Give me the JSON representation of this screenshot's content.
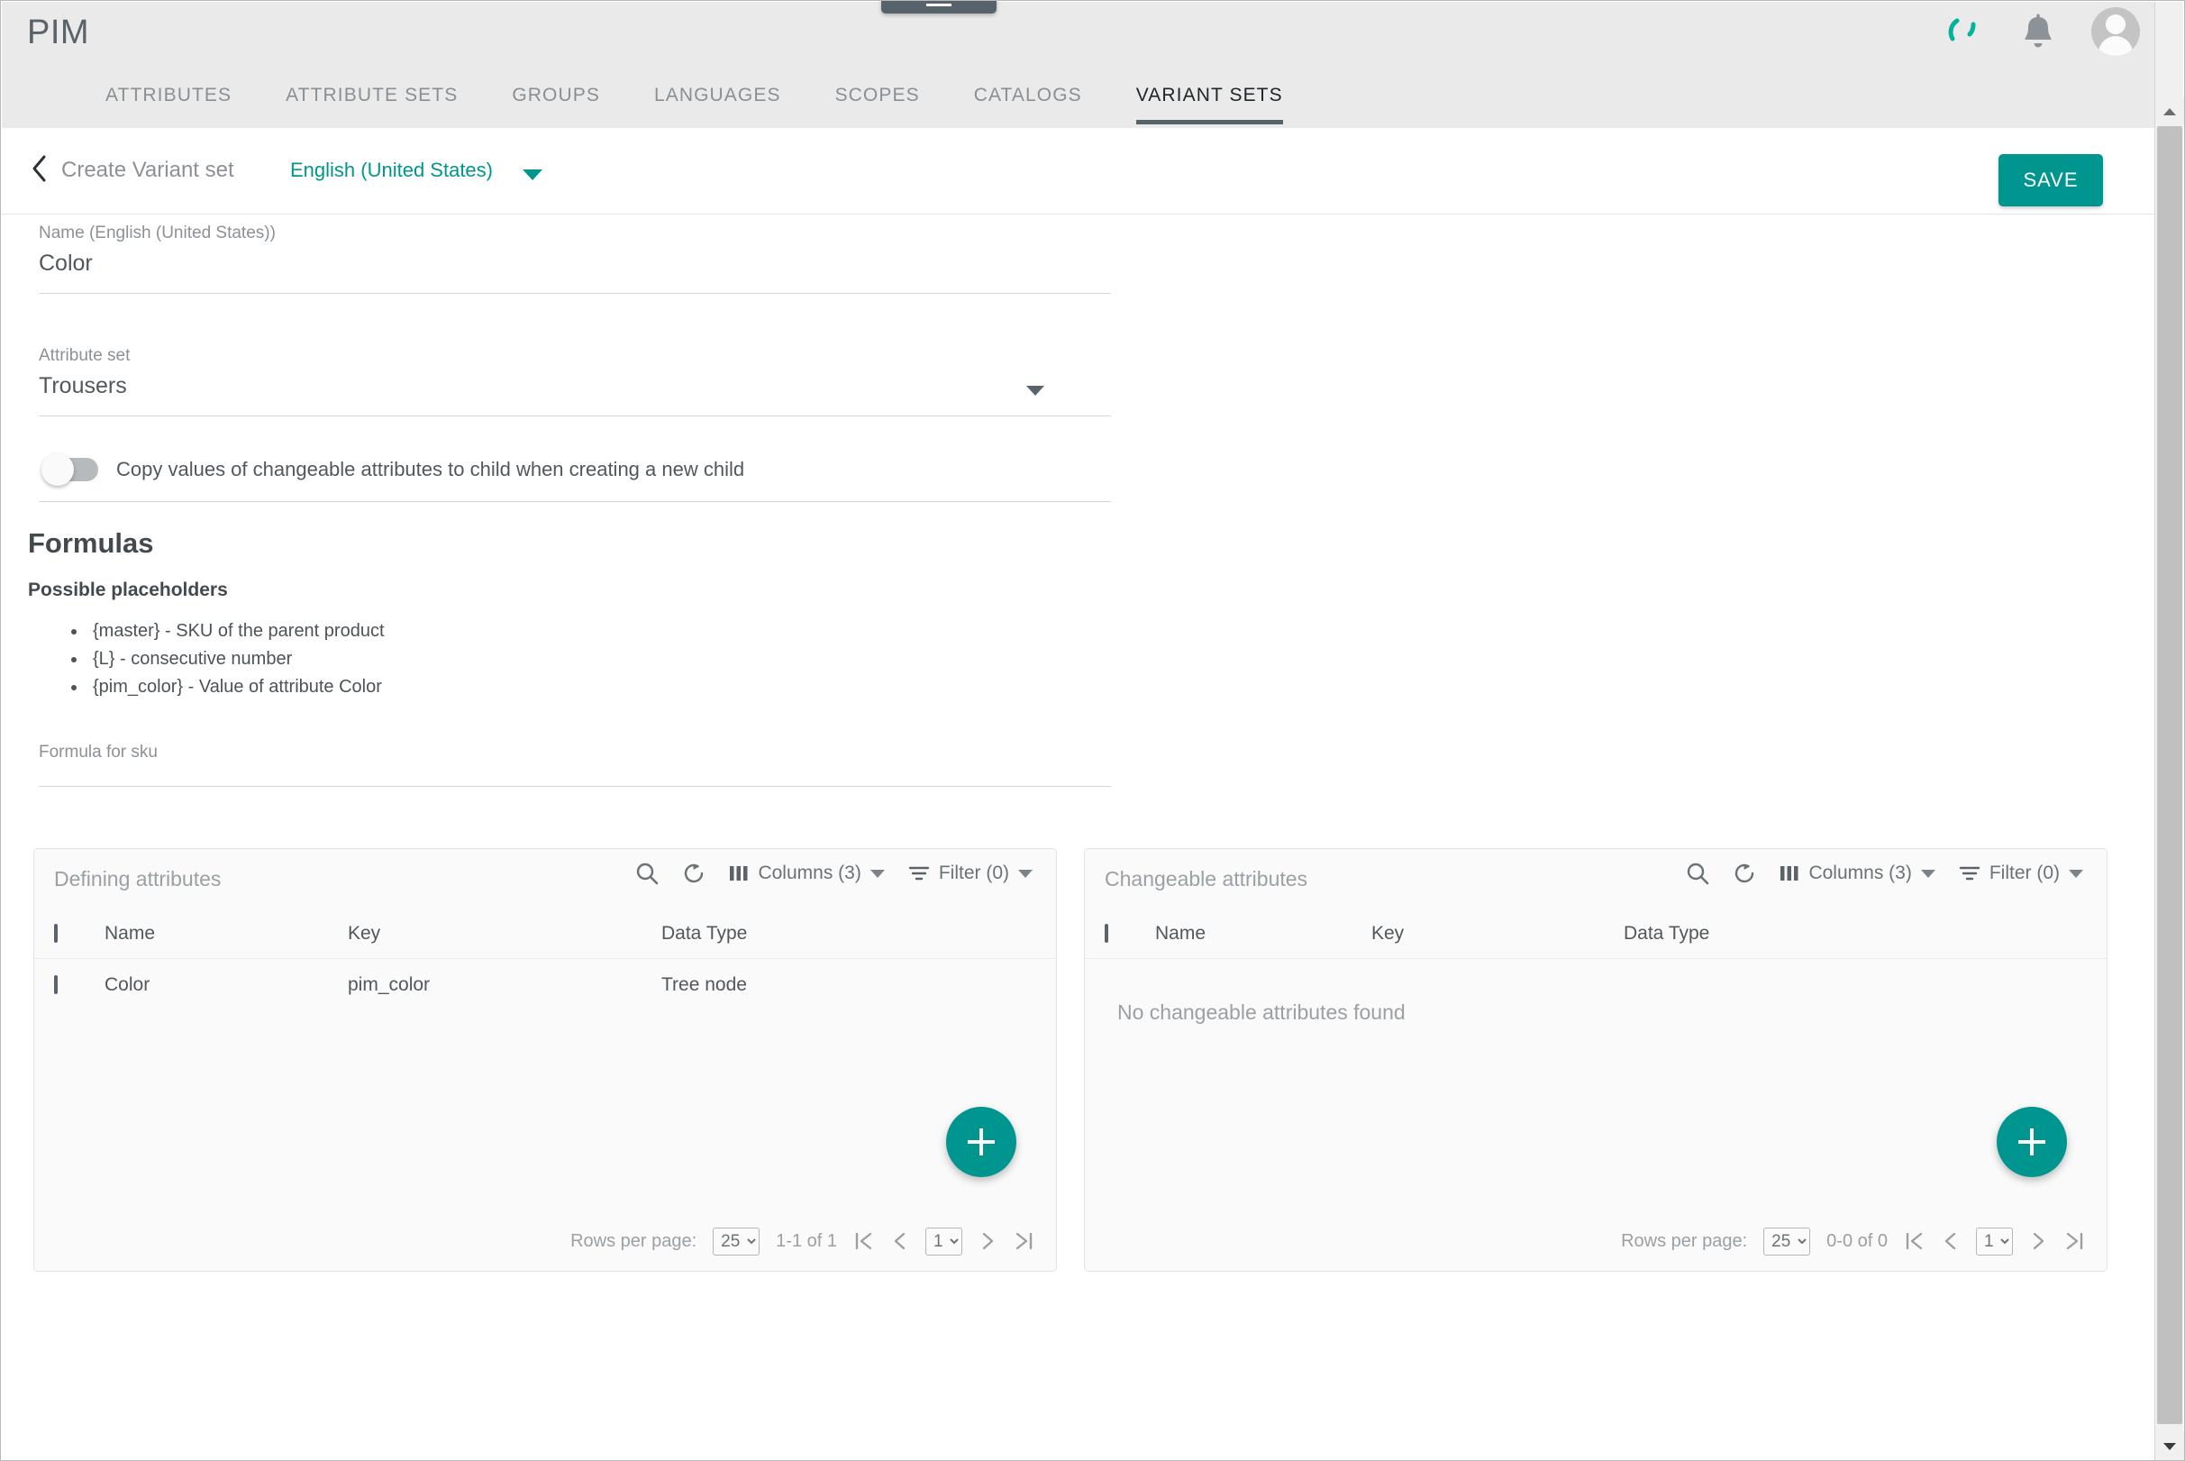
{
  "app": {
    "brand": "PIM",
    "menu_icon": "hamburger-icon",
    "sync_icon": "sync-spinner-icon",
    "notifications_icon": "bell-icon",
    "account_icon": "avatar-icon"
  },
  "nav": {
    "tabs": [
      {
        "label": "ATTRIBUTES",
        "active": false
      },
      {
        "label": "ATTRIBUTE SETS",
        "active": false
      },
      {
        "label": "GROUPS",
        "active": false
      },
      {
        "label": "LANGUAGES",
        "active": false
      },
      {
        "label": "SCOPES",
        "active": false
      },
      {
        "label": "CATALOGS",
        "active": false
      },
      {
        "label": "VARIANT SETS",
        "active": true
      }
    ]
  },
  "subheader": {
    "back_icon": "chevron-left-icon",
    "title": "Create Variant set",
    "language": "English (United States)",
    "language_caret": "chevron-down-icon",
    "save_label": "SAVE"
  },
  "form": {
    "name_field": {
      "label": "Name (English (United States))",
      "value": "Color"
    },
    "attribute_set_field": {
      "label": "Attribute set",
      "value": "Trousers",
      "caret": "chevron-down-icon"
    },
    "copy_toggle": {
      "label": "Copy values of changeable attributes to child when creating a new child",
      "checked": false
    }
  },
  "formulas": {
    "heading": "Formulas",
    "placeholders_heading": "Possible placeholders",
    "placeholders": [
      "{master} - SKU of the parent product",
      "{L} - consecutive number",
      "{pim_color} - Value of attribute Color"
    ],
    "sku_field": {
      "label": "Formula for sku",
      "value": "",
      "placeholder": ""
    }
  },
  "panels": [
    {
      "title": "Defining attributes",
      "tools": {
        "search_icon": "search-icon",
        "refresh_icon": "refresh-icon",
        "columns_icon": "columns-icon",
        "columns_label": "Columns (3)",
        "filter_icon": "filter-icon",
        "filter_label": "Filter (0)"
      },
      "columns": [
        "Name",
        "Key",
        "Data Type"
      ],
      "rows": [
        {
          "name": "Color",
          "key": "pim_color",
          "type": "Tree node"
        }
      ],
      "empty_message": "",
      "add_label": "+",
      "footer": {
        "rows_per_page_label": "Rows per page:",
        "rows_per_page_value": "25",
        "rows_per_page_options": [
          "25"
        ],
        "range": "1-1 of 1",
        "page_value": "1",
        "page_options": [
          "1"
        ]
      }
    },
    {
      "title": "Changeable attributes",
      "tools": {
        "search_icon": "search-icon",
        "refresh_icon": "refresh-icon",
        "columns_icon": "columns-icon",
        "columns_label": "Columns (3)",
        "filter_icon": "filter-icon",
        "filter_label": "Filter (0)"
      },
      "columns": [
        "Name",
        "Key",
        "Data Type"
      ],
      "rows": [],
      "empty_message": "No changeable attributes found",
      "add_label": "+",
      "footer": {
        "rows_per_page_label": "Rows per page:",
        "rows_per_page_value": "25",
        "rows_per_page_options": [
          "25"
        ],
        "range": "0-0 of 0",
        "page_value": "1",
        "page_options": [
          "1"
        ]
      }
    }
  ],
  "colors": {
    "accent": "#00968f",
    "appbar_bg": "#eaeaea",
    "active_tab_underline": "#57636a",
    "text_primary": "#51585d",
    "text_muted": "#9aa0a4"
  }
}
